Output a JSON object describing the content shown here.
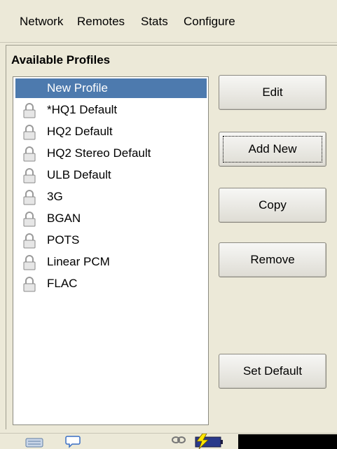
{
  "menubar": {
    "items": [
      "Network",
      "Remotes",
      "Stats",
      "Configure"
    ]
  },
  "panel": {
    "title": "Available Profiles"
  },
  "profiles": [
    {
      "label": "New Profile",
      "locked": false,
      "selected": true
    },
    {
      "label": "*HQ1 Default",
      "locked": true
    },
    {
      "label": "HQ2 Default",
      "locked": true
    },
    {
      "label": "HQ2 Stereo Default",
      "locked": true
    },
    {
      "label": "ULB Default",
      "locked": true
    },
    {
      "label": "3G",
      "locked": true
    },
    {
      "label": "BGAN",
      "locked": true
    },
    {
      "label": "POTS",
      "locked": true
    },
    {
      "label": "Linear PCM",
      "locked": true
    },
    {
      "label": "FLAC",
      "locked": true
    }
  ],
  "buttons": {
    "edit": "Edit",
    "add_new": "Add New",
    "copy": "Copy",
    "remove": "Remove",
    "set_default": "Set Default"
  },
  "statusbar": {
    "icons": [
      "keyboard-icon",
      "chat-bubble-icon",
      "link-icon",
      "battery-charging-icon"
    ]
  },
  "colors": {
    "selection": "#4d7aae",
    "background": "#ece9d8"
  }
}
